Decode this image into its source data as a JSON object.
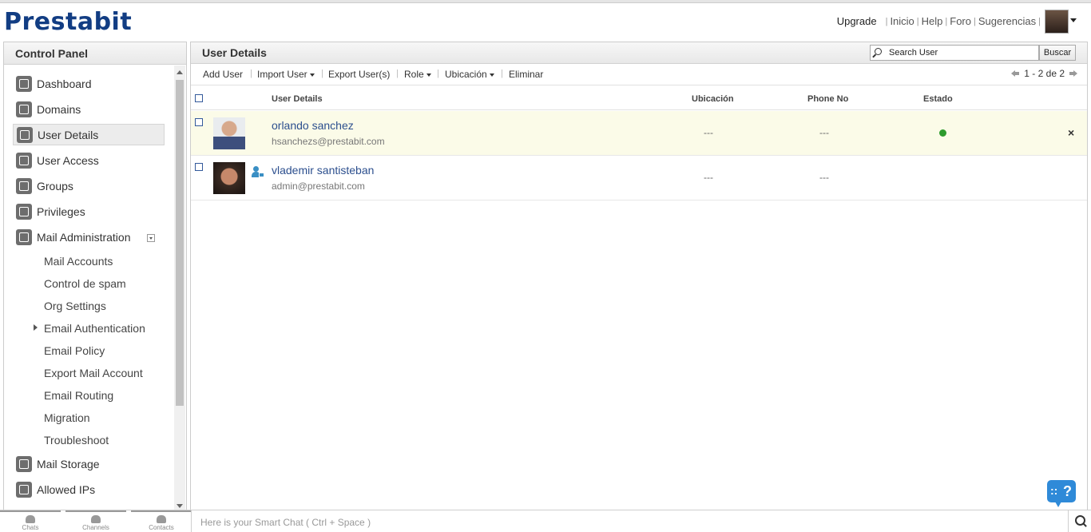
{
  "brand": {
    "logo_text": "Prestabit",
    "accent": "#123d83"
  },
  "topnav": {
    "upgrade": "Upgrade",
    "links": [
      "Inicio",
      "Help",
      "Foro",
      "Sugerencias"
    ]
  },
  "sidebar": {
    "title": "Control Panel",
    "items": [
      {
        "label": "Dashboard",
        "icon": "dashboard-icon"
      },
      {
        "label": "Domains",
        "icon": "globe-icon"
      },
      {
        "label": "User Details",
        "icon": "user-icon",
        "active": true
      },
      {
        "label": "User Access",
        "icon": "user-access-icon"
      },
      {
        "label": "Groups",
        "icon": "groups-icon"
      },
      {
        "label": "Privileges",
        "icon": "document-icon"
      },
      {
        "label": "Mail Administration",
        "icon": "mail-icon",
        "expanded": true
      },
      {
        "label": "Mail Storage",
        "icon": "storage-icon"
      },
      {
        "label": "Allowed IPs",
        "icon": "ip-icon"
      }
    ],
    "mail_sub_items": [
      "Mail Accounts",
      "Control de spam",
      "Org Settings",
      "Email Authentication",
      "Email Policy",
      "Export Mail Account",
      "Email Routing",
      "Migration",
      "Troubleshoot"
    ]
  },
  "main": {
    "title": "User Details",
    "search": {
      "placeholder": "Search User",
      "button": "Buscar"
    },
    "toolbar": [
      "Add User",
      "Import User",
      "Export User(s)",
      "Role",
      "Ubicación",
      "Eliminar"
    ],
    "pager": "1 - 2 de 2",
    "columns": [
      "User Details",
      "Ubicación",
      "Phone No",
      "Estado"
    ],
    "rows": [
      {
        "name": "orlando sanchez",
        "email": "hsanchezs@prestabit.com",
        "ubicacion": "---",
        "phone": "---",
        "estado_color": "#2d9b2d",
        "close": "×"
      },
      {
        "name": "vlademir santisteban",
        "email": "admin@prestabit.com",
        "ubicacion": "---",
        "phone": "---",
        "is_admin": true
      }
    ]
  },
  "bottom": {
    "tabs": [
      "Chats",
      "Channels",
      "Contacts"
    ],
    "chat_placeholder": "Here is your Smart Chat ( Ctrl + Space )",
    "help_label": "?"
  }
}
